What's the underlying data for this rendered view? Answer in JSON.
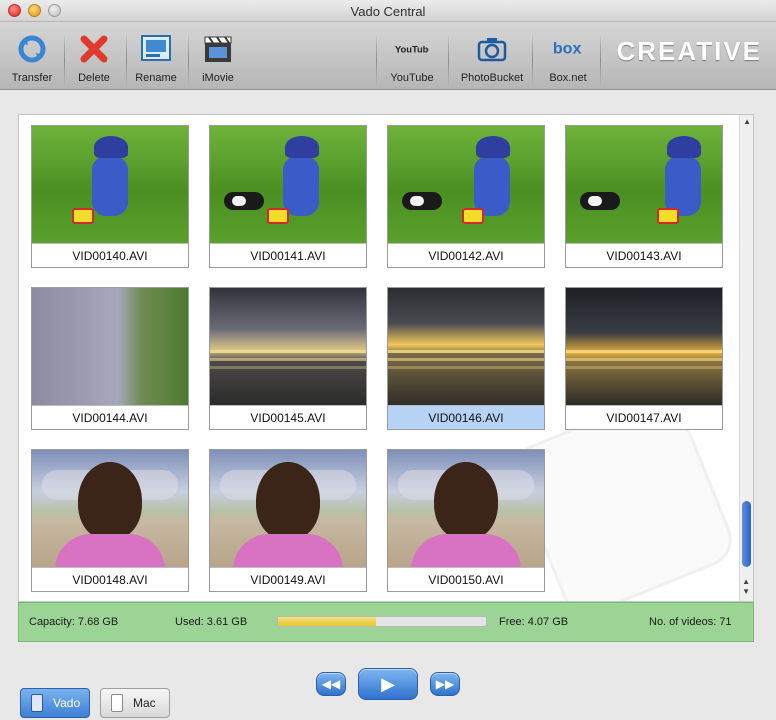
{
  "window": {
    "title": "Vado Central"
  },
  "toolbar": {
    "left": [
      {
        "label": "Transfer",
        "icon": "transfer-icon"
      },
      {
        "label": "Delete",
        "icon": "delete-icon"
      },
      {
        "label": "Rename",
        "icon": "rename-icon"
      },
      {
        "label": "iMovie",
        "icon": "imovie-icon"
      }
    ],
    "right": [
      {
        "label": "YouTube",
        "icon": "youtube-icon"
      },
      {
        "label": "PhotoBucket",
        "icon": "photobucket-icon"
      },
      {
        "label": "Box.net",
        "icon": "boxnet-icon"
      }
    ],
    "brand": "CREATIVE",
    "youtube_logo": "YouTube",
    "boxnet_logo": "box"
  },
  "videos": [
    {
      "name": "VID00140.AVI",
      "scene": "grass",
      "selected": false
    },
    {
      "name": "VID00141.AVI",
      "scene": "grass",
      "selected": false
    },
    {
      "name": "VID00142.AVI",
      "scene": "grass",
      "selected": false
    },
    {
      "name": "VID00143.AVI",
      "scene": "grass",
      "selected": false
    },
    {
      "name": "VID00144.AVI",
      "scene": "path",
      "selected": false
    },
    {
      "name": "VID00145.AVI",
      "scene": "sunset1",
      "selected": false
    },
    {
      "name": "VID00146.AVI",
      "scene": "sunset2",
      "selected": true
    },
    {
      "name": "VID00147.AVI",
      "scene": "sunset3",
      "selected": false
    },
    {
      "name": "VID00148.AVI",
      "scene": "beach",
      "selected": false
    },
    {
      "name": "VID00149.AVI",
      "scene": "beach",
      "selected": false
    },
    {
      "name": "VID00150.AVI",
      "scene": "beach",
      "selected": false
    }
  ],
  "status": {
    "capacity": "Capacity: 7.68 GB",
    "used": "Used: 3.61 GB",
    "free": "Free: 4.07 GB",
    "count": "No. of videos: 71",
    "used_fraction": 0.47
  },
  "tabs": {
    "vado": "Vado",
    "mac": "Mac"
  },
  "player": {
    "prev": "◀◀",
    "play": "▶",
    "next": "▶▶"
  },
  "colors": {
    "status_green": "#9cd496",
    "selection_blue": "#b7d3f5",
    "progress_yellow": "#e4c431"
  }
}
